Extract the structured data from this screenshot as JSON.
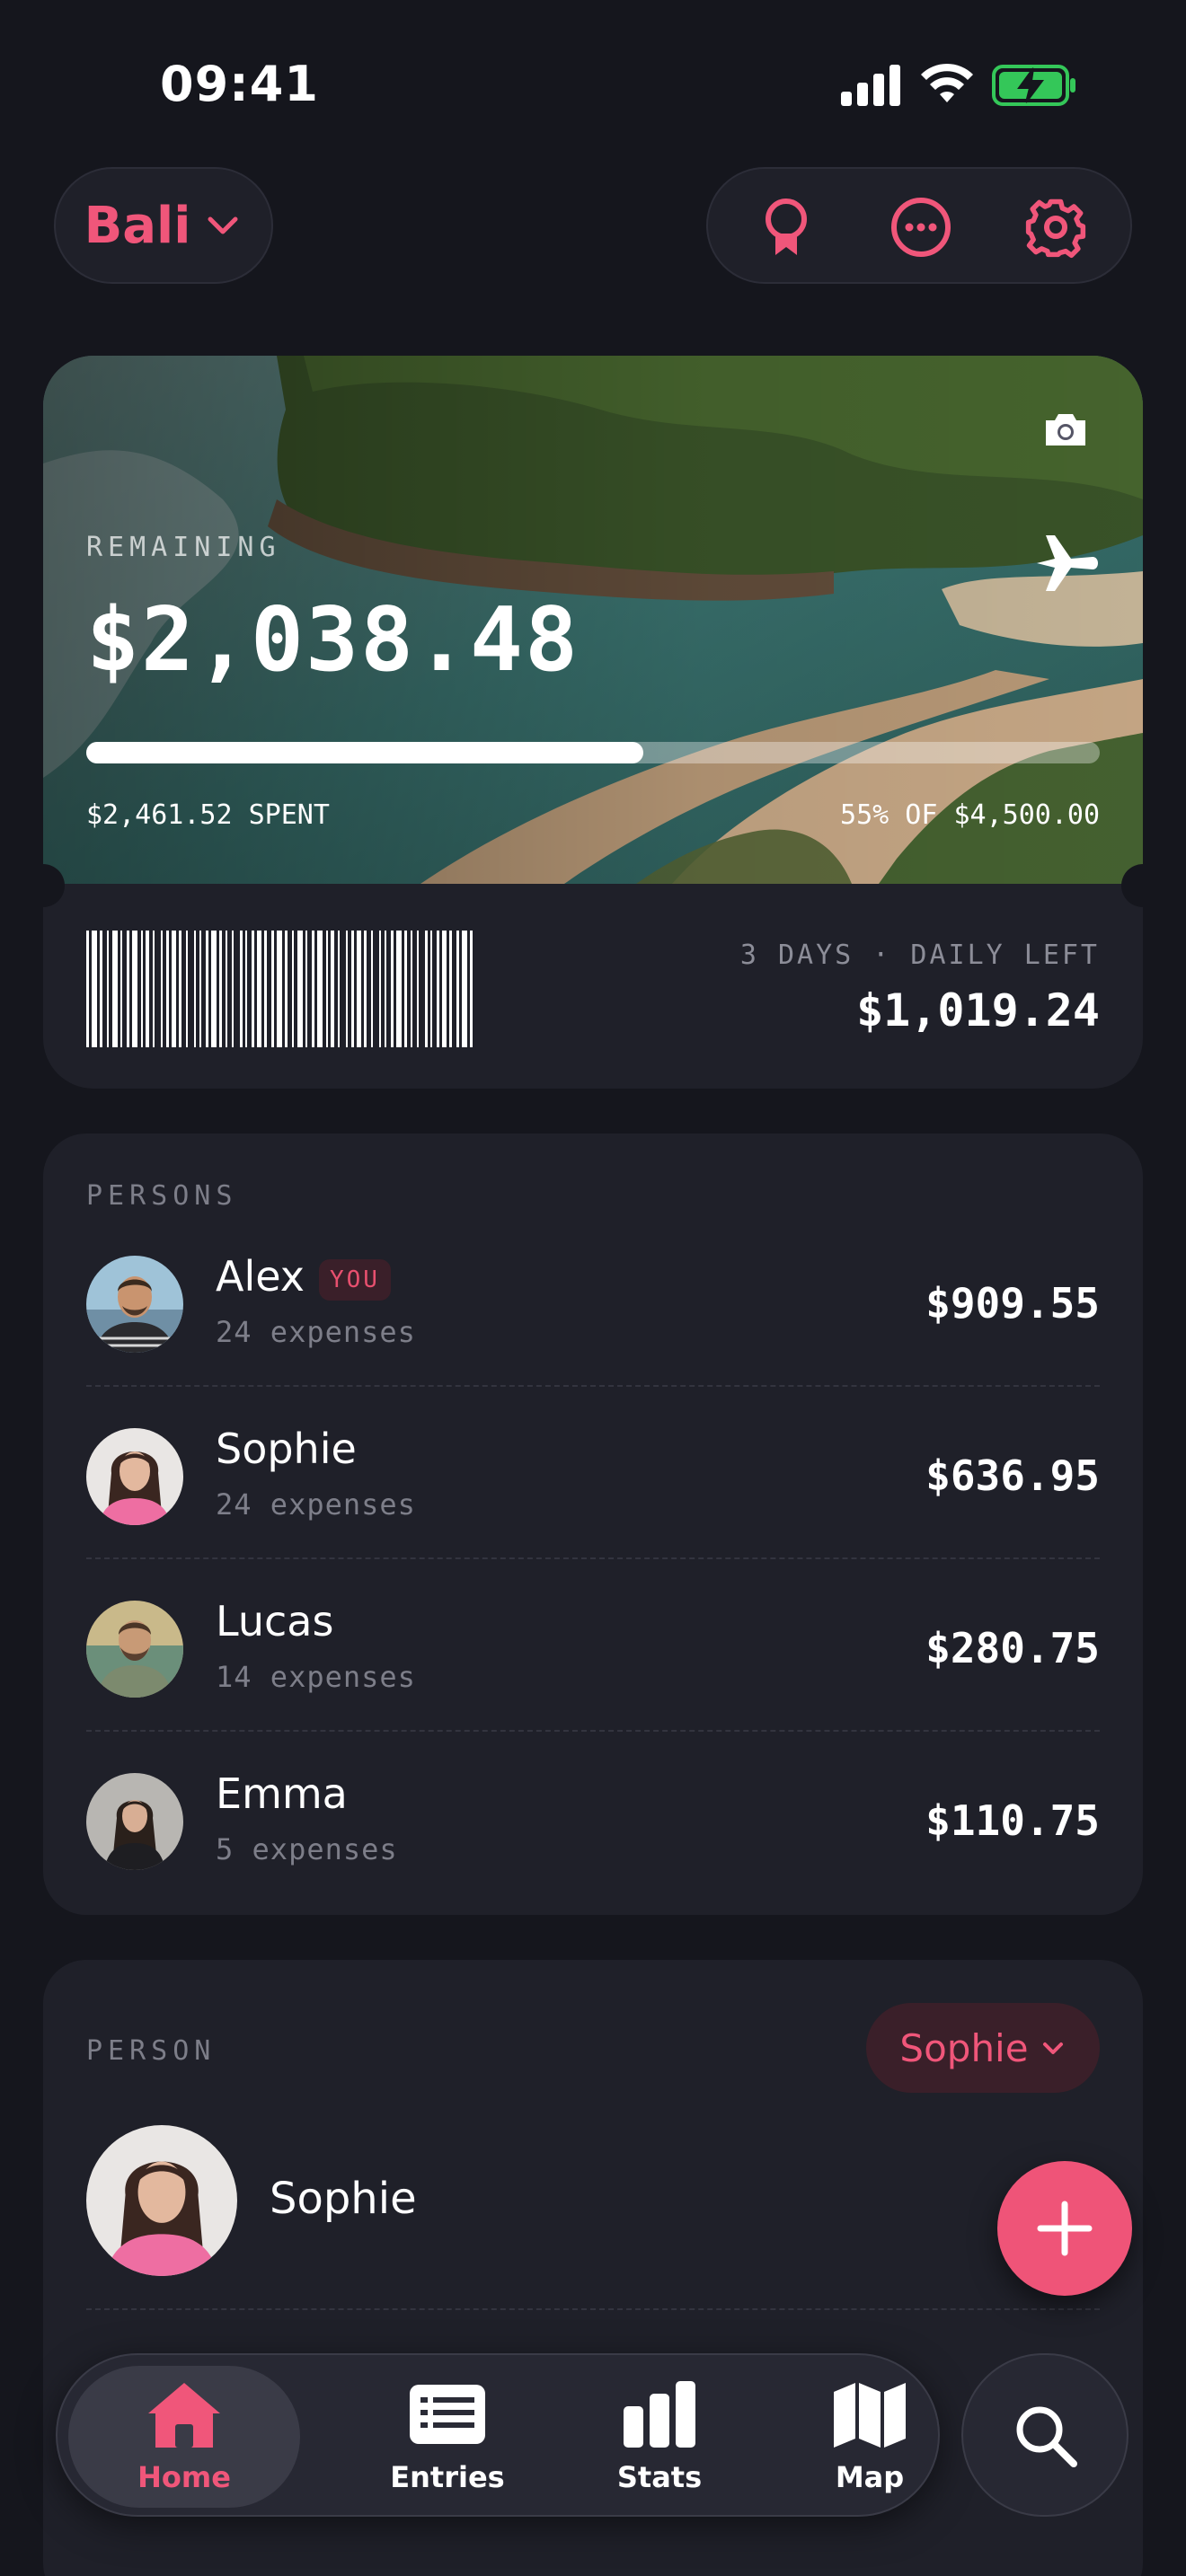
{
  "status_bar": {
    "time": "09:41"
  },
  "trip": {
    "name": "Bali"
  },
  "actions": [
    "badge-icon",
    "more-icon",
    "settings-icon"
  ],
  "budget": {
    "remaining_label": "REMAINING",
    "remaining_amount": "$2,038.48",
    "spent_text": "$2,461.52 SPENT",
    "percent_text": "55% OF $4,500.00",
    "progress_fraction": 0.55,
    "daily_label": "3 DAYS · DAILY LEFT",
    "daily_amount": "$1,019.24"
  },
  "persons": {
    "label": "PERSONS",
    "you_badge": "YOU",
    "items": [
      {
        "name": "Alex",
        "count": "24 expenses",
        "amount": "$909.55"
      },
      {
        "name": "Sophie",
        "count": "24 expenses",
        "amount": "$636.95"
      },
      {
        "name": "Lucas",
        "count": "14 expenses",
        "amount": "$280.75"
      },
      {
        "name": "Emma",
        "count": "5 expenses",
        "amount": "$110.75"
      }
    ]
  },
  "person_detail": {
    "label": "PERSON",
    "selected": "Sophie",
    "name": "Sophie"
  },
  "nav": {
    "items": [
      {
        "label": "Home",
        "icon": "home-icon",
        "active": true
      },
      {
        "label": "Entries",
        "icon": "list-icon",
        "active": false
      },
      {
        "label": "Stats",
        "icon": "bar-chart-icon",
        "active": false
      },
      {
        "label": "Map",
        "icon": "map-icon",
        "active": false
      }
    ],
    "search_icon": "search-icon"
  },
  "colors": {
    "accent": "#ef5478",
    "background": "#15161d",
    "card": "#1f2029"
  }
}
